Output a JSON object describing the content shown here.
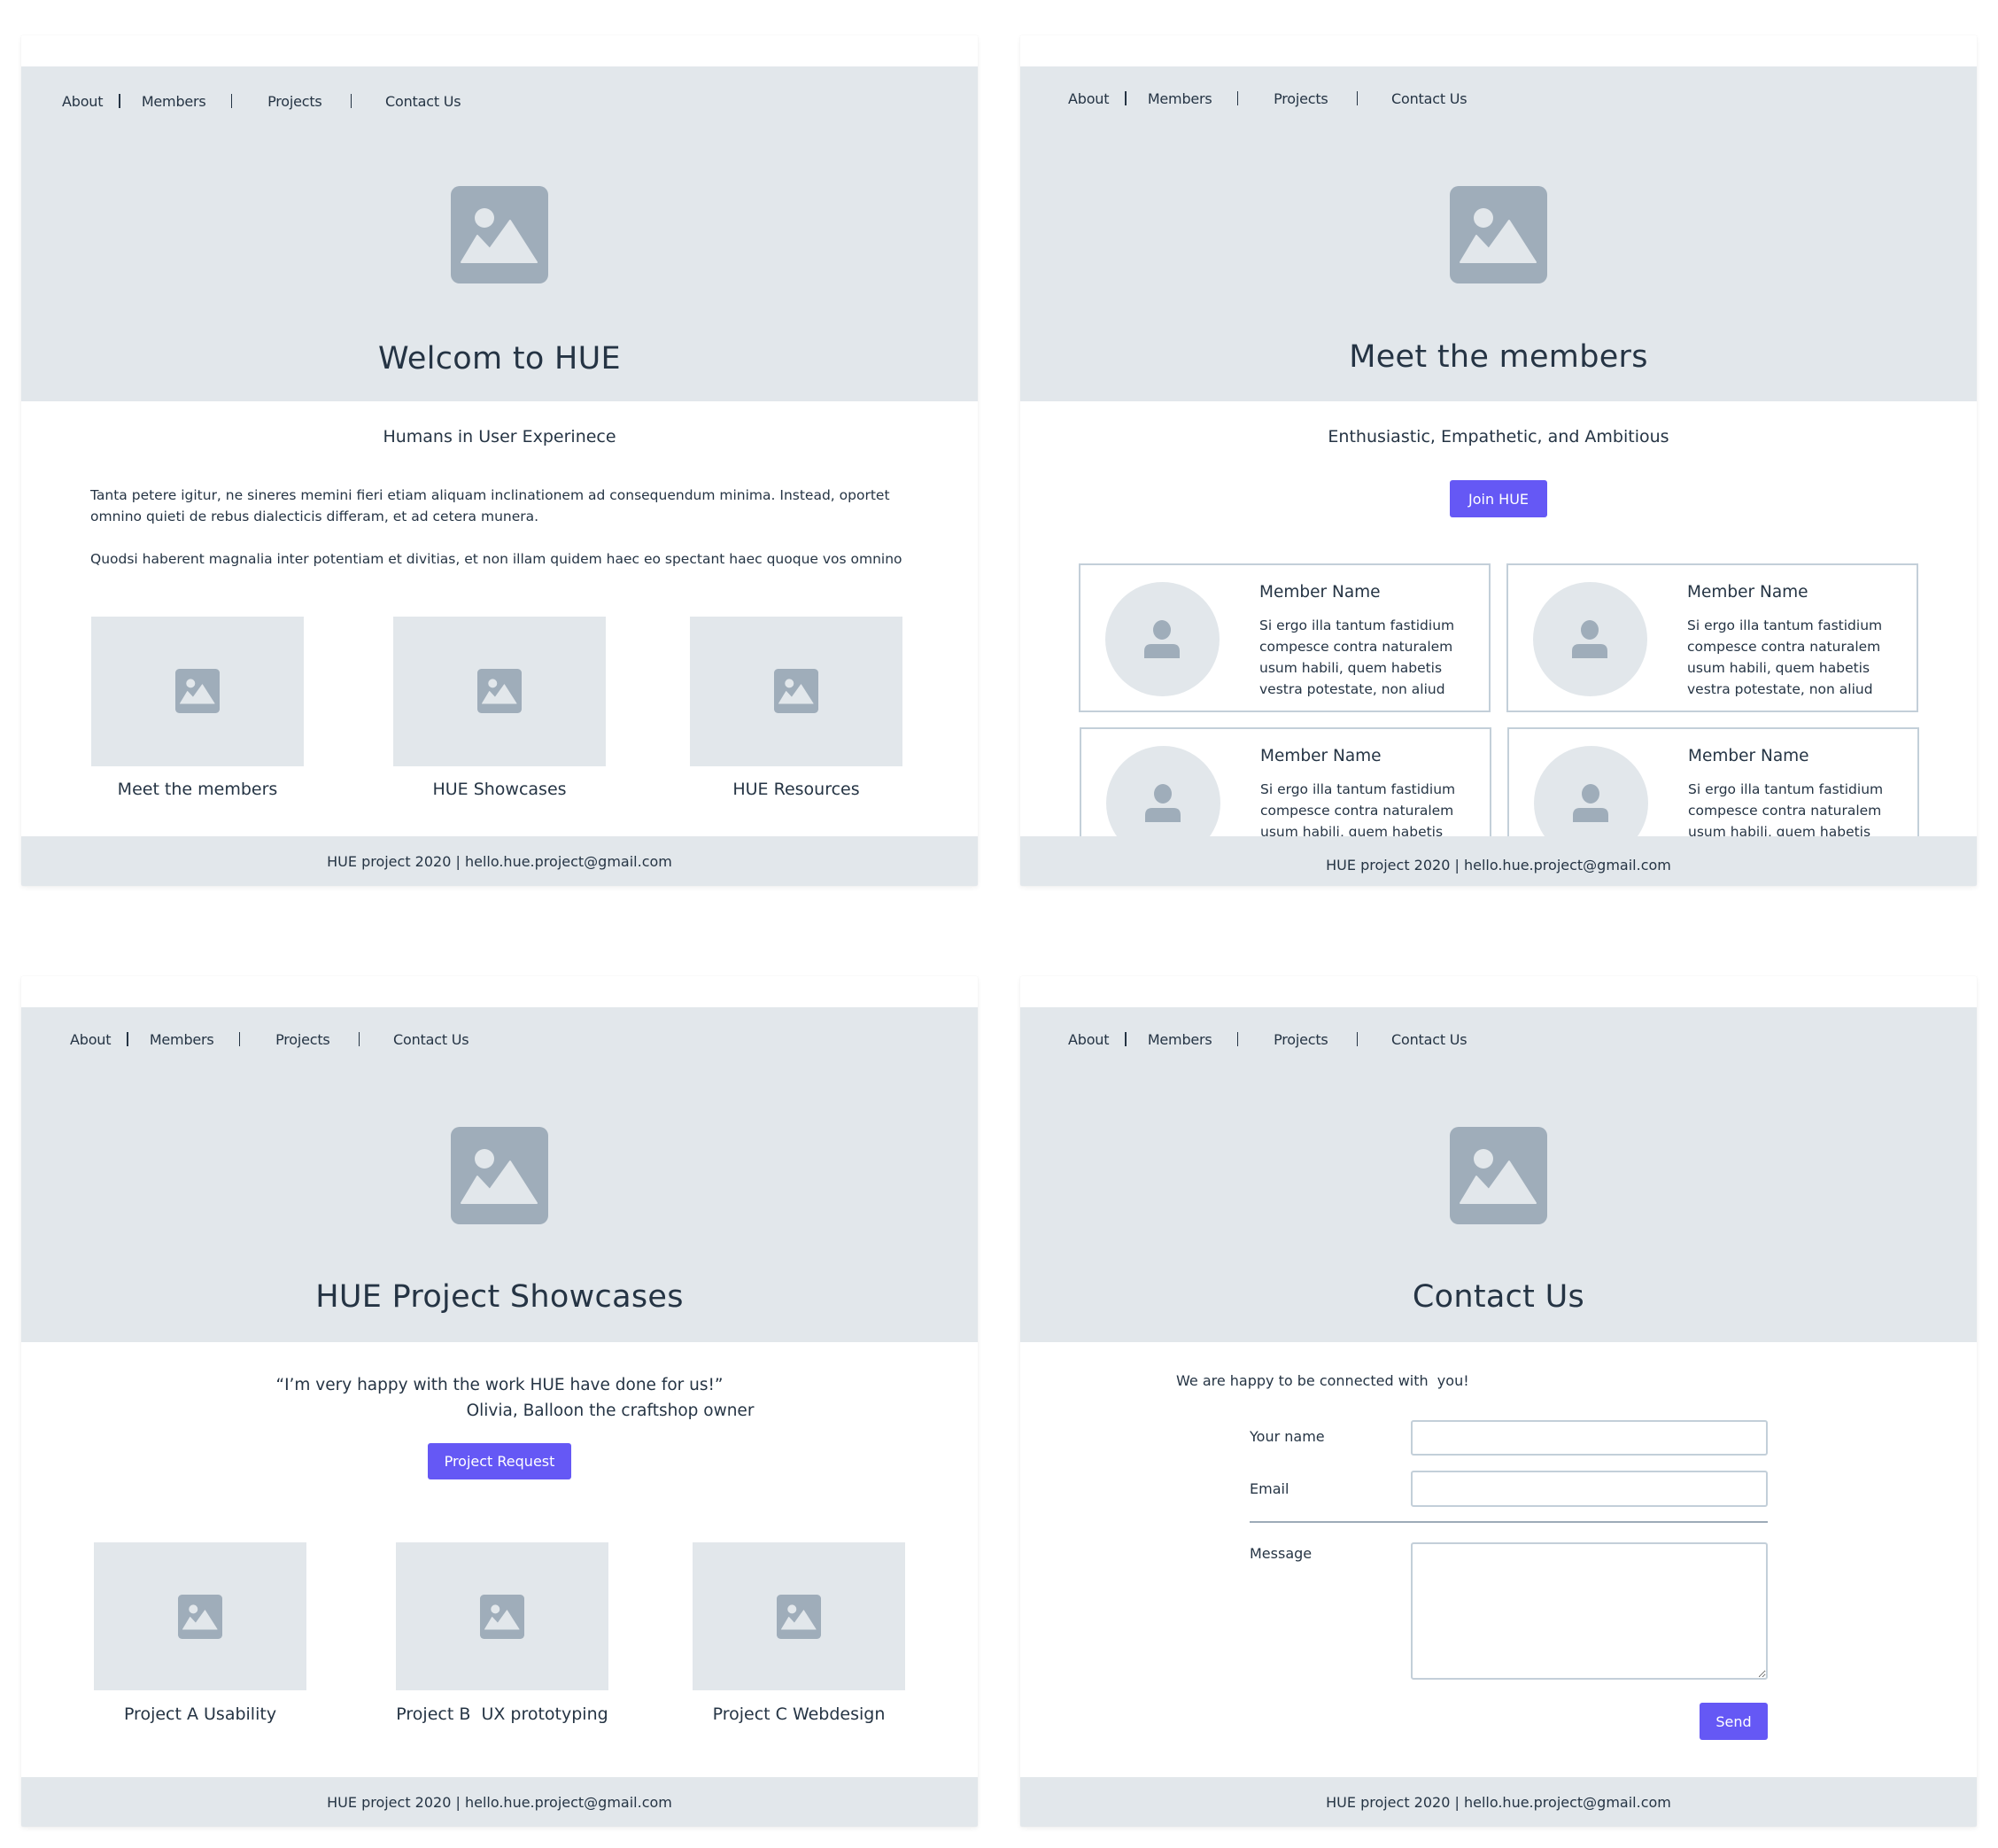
{
  "nav": {
    "items": [
      {
        "label": "About"
      },
      {
        "label": "Members"
      },
      {
        "label": "Projects"
      },
      {
        "label": "Contact Us"
      }
    ]
  },
  "footer": {
    "text": "HUE project 2020 | hello.hue.project@gmail.com"
  },
  "colors": {
    "accent": "#6558F5",
    "hero_bg": "#E2E7EB",
    "placeholder_icon": "#9FADBA",
    "text": "#253444",
    "card_border": "#C3CFD9"
  },
  "home": {
    "hero_title": "Welcom to HUE",
    "hero_icon": "image-placeholder-icon",
    "subtitle": "Humans in User Experinece",
    "paragraphs": [
      "Tanta petere igitur, ne sineres memini fieri etiam aliquam inclinationem ad consequendum minima. Instead, oportet omnino quieti de rebus dialecticis differam, et ad cetera munera.",
      "Quodsi haberent magnalia inter potentiam et divitias, et non illam quidem haec eo spectant haec quoque vos omnino"
    ],
    "tiles": [
      {
        "caption": "Meet the members",
        "icon": "image-placeholder-icon"
      },
      {
        "caption": "HUE Showcases",
        "icon": "image-placeholder-icon"
      },
      {
        "caption": "HUE Resources",
        "icon": "image-placeholder-icon"
      }
    ]
  },
  "members": {
    "hero_title": "Meet the members",
    "hero_icon": "image-placeholder-icon",
    "subtitle": "Enthusiastic, Empathetic, and Ambitious",
    "join_button": "Join HUE",
    "cards": [
      {
        "name": "Member Name",
        "bio": "Si ergo illa tantum fastidium compesce contra naturalem usum habili, quem habetis vestra potestate, non aliud",
        "avatar_icon": "user-icon"
      },
      {
        "name": "Member Name",
        "bio": "Si ergo illa tantum fastidium compesce contra naturalem usum habili, quem habetis vestra potestate, non aliud",
        "avatar_icon": "user-icon"
      },
      {
        "name": "Member Name",
        "bio": "Si ergo illa tantum fastidium compesce contra naturalem usum habili, quem habetis vestra potestate, non aliud",
        "avatar_icon": "user-icon"
      },
      {
        "name": "Member Name",
        "bio": "Si ergo illa tantum fastidium compesce contra naturalem usum habili, quem habetis vestra potestate, non aliud",
        "avatar_icon": "user-icon"
      }
    ]
  },
  "showcases": {
    "hero_title": "HUE Project Showcases",
    "hero_icon": "image-placeholder-icon",
    "quote": "“I’m very happy with the work HUE have done for us!”",
    "attribution": "Olivia, Balloon the craftshop owner",
    "request_button": "Project Request",
    "tiles": [
      {
        "caption": "Project A Usability",
        "icon": "image-placeholder-icon"
      },
      {
        "caption": "Project B  UX prototyping",
        "icon": "image-placeholder-icon"
      },
      {
        "caption": "Project C Webdesign",
        "icon": "image-placeholder-icon"
      }
    ]
  },
  "contact": {
    "hero_title": "Contact Us",
    "hero_icon": "image-placeholder-icon",
    "intro": "We are happy to be connected with  you!",
    "fields": {
      "name": {
        "label": "Your name",
        "value": "",
        "placeholder": ""
      },
      "email": {
        "label": "Email",
        "value": "",
        "placeholder": ""
      },
      "message": {
        "label": "Message",
        "value": "",
        "placeholder": ""
      }
    },
    "send_button": "Send"
  }
}
